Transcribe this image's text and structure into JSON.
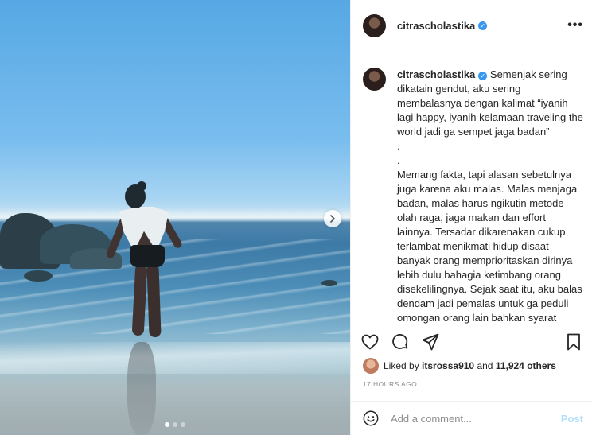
{
  "header": {
    "username": "citrascholastika",
    "verified_icon": "verified-badge-icon",
    "more_icon": "more-options-icon"
  },
  "caption": {
    "username": "citrascholastika",
    "lines": [
      "Semenjak sering dikatain gendut, aku sering membalasnya dengan kalimat “iyanih lagi happy, iyanih kelamaan traveling the world jadi ga sempet jaga badan”",
      ".",
      ".",
      "Memang fakta, tapi alasan sebetulnya juga karena aku malas. Malas menjaga badan, malas harus ngikutin metode olah raga, jaga makan dan effort lainnya. Tersadar dikarenakan cukup terlambat menikmati hidup disaat banyak orang memprioritaskan dirinya lebih dulu bahagia ketimbang orang disekelilingnya. Sejak saat itu, aku balas dendam jadi pemalas untuk ga peduli omongan orang lain bahkan syarat menjadi “terpakai” di dunia"
    ]
  },
  "actions": {
    "like_icon": "heart-icon",
    "comment_icon": "comment-icon",
    "share_icon": "share-icon",
    "save_icon": "bookmark-icon"
  },
  "likes": {
    "prefix": "Liked by",
    "liker": "itsrossa910",
    "conjunction": "and",
    "others": "11,924 others"
  },
  "timestamp": "17 HOURS AGO",
  "comment_box": {
    "placeholder": "Add a comment...",
    "post_label": "Post",
    "emoji_icon": "smiley-icon"
  },
  "carousel": {
    "current_index": 1,
    "total": 3,
    "next_icon": "chevron-right-icon"
  },
  "colors": {
    "link_blue": "#3897f0",
    "post_button_disabled": "#b2dffc",
    "text": "#262626",
    "muted": "#8e8e8e"
  }
}
